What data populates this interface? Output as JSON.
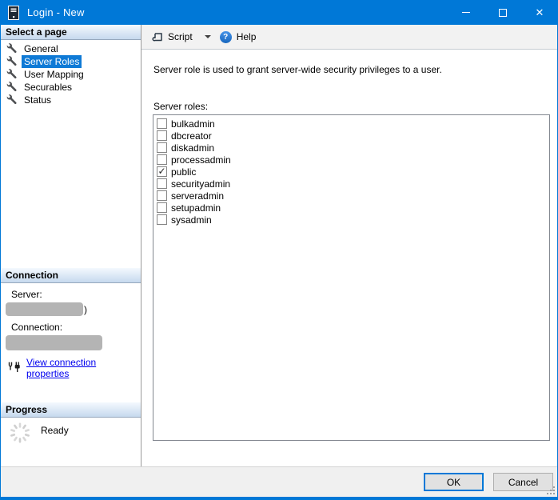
{
  "window": {
    "title": "Login - New"
  },
  "titlebar_controls": {
    "close_glyph": "✕"
  },
  "toolbar": {
    "script_label": "Script",
    "help_label": "Help",
    "help_glyph": "?"
  },
  "sidebar": {
    "pages": {
      "header": "Select a page",
      "items": [
        {
          "label": "General",
          "selected": false
        },
        {
          "label": "Server Roles",
          "selected": true
        },
        {
          "label": "User Mapping",
          "selected": false
        },
        {
          "label": "Securables",
          "selected": false
        },
        {
          "label": "Status",
          "selected": false
        }
      ]
    },
    "connection": {
      "header": "Connection",
      "server_label": "Server:",
      "server_visible_text": ")",
      "connection_label": "Connection:",
      "link_label": "View connection properties"
    },
    "progress": {
      "header": "Progress",
      "status": "Ready"
    }
  },
  "main": {
    "description": "Server role is used to grant server-wide security privileges to a user.",
    "roles_label": "Server roles:",
    "roles": [
      {
        "name": "bulkadmin",
        "checked": false
      },
      {
        "name": "dbcreator",
        "checked": false
      },
      {
        "name": "diskadmin",
        "checked": false
      },
      {
        "name": "processadmin",
        "checked": false
      },
      {
        "name": "public",
        "checked": true
      },
      {
        "name": "securityadmin",
        "checked": false
      },
      {
        "name": "serveradmin",
        "checked": false
      },
      {
        "name": "setupadmin",
        "checked": false
      },
      {
        "name": "sysadmin",
        "checked": false
      }
    ]
  },
  "footer": {
    "ok_label": "OK",
    "cancel_label": "Cancel"
  },
  "icons": {
    "check_glyph": "✓",
    "app": "login-app-icon",
    "script": "script-icon",
    "help": "help-circle-icon",
    "page_item": "wrench-icon",
    "connection_link": "plug-icon",
    "progress": "spinner-icon"
  },
  "colors": {
    "titlebar": "#0078d7",
    "selection": "#0f7ad6",
    "link": "#0000ee",
    "redaction": "#b4b4b4",
    "button_face": "#e1e1e1",
    "ok_border": "#0078d7"
  }
}
